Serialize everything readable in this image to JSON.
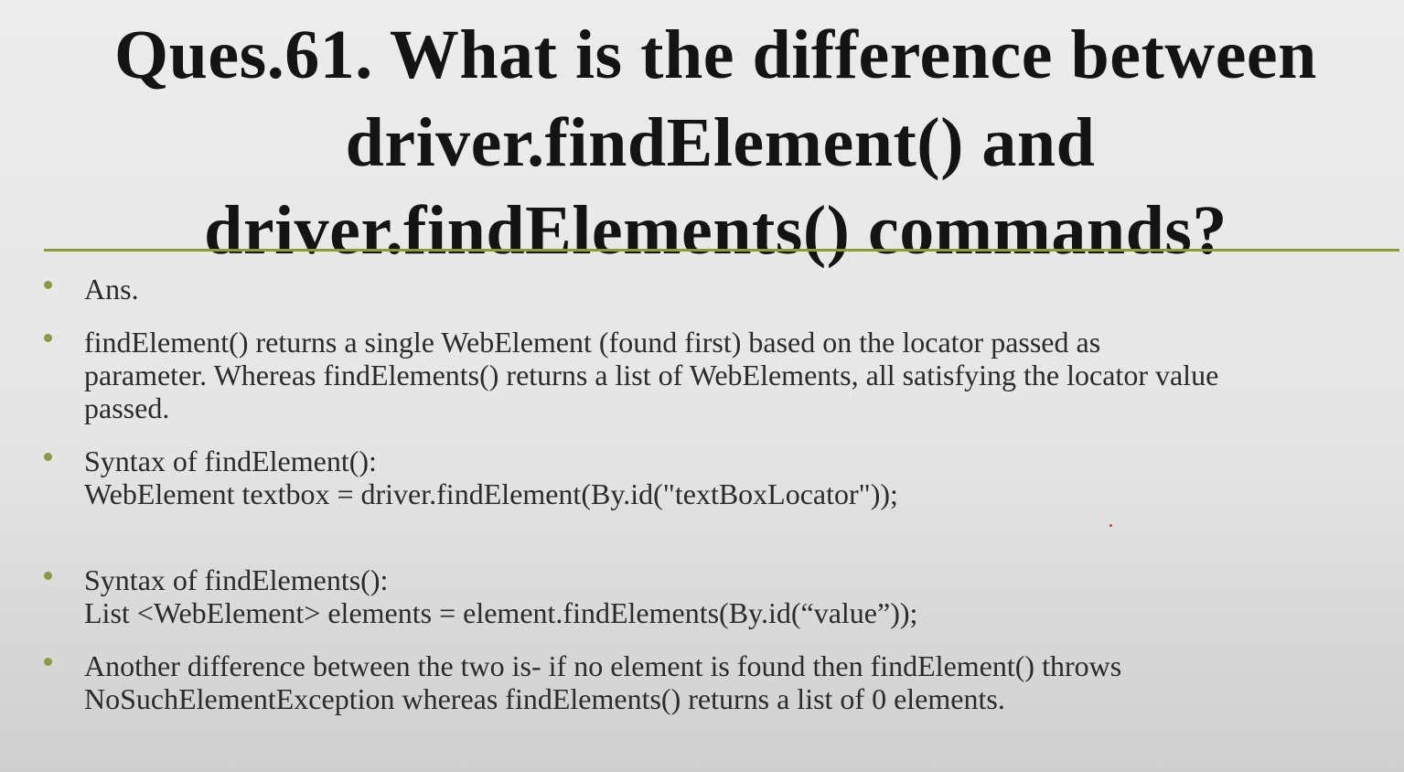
{
  "title": {
    "line1": "Ques.61. What is the difference between",
    "line2": "driver.findElement() and",
    "line3": "driver.findElements() commands?"
  },
  "bullets": [
    {
      "lines": [
        "Ans."
      ]
    },
    {
      "lines": [
        "findElement() returns a single WebElement (found first) based on the locator passed as",
        "parameter. Whereas findElements() returns a list of WebElements, all satisfying the locator value",
        "passed."
      ]
    },
    {
      "lines": [
        "Syntax of findElement():",
        "WebElement textbox = driver.findElement(By.id(\"textBoxLocator\"));"
      ]
    },
    {
      "lines": [
        "Syntax of findElements():",
        "List <WebElement> elements = element.findElements(By.id(“value”));"
      ]
    },
    {
      "lines": [
        "Another difference between the two is- if no element is found then findElement() throws",
        "NoSuchElementException whereas findElements() returns a list of 0 elements."
      ]
    }
  ],
  "colors": {
    "accent": "#8a9a3f",
    "title_text": "#141414",
    "body_text": "#2b2b2b"
  }
}
